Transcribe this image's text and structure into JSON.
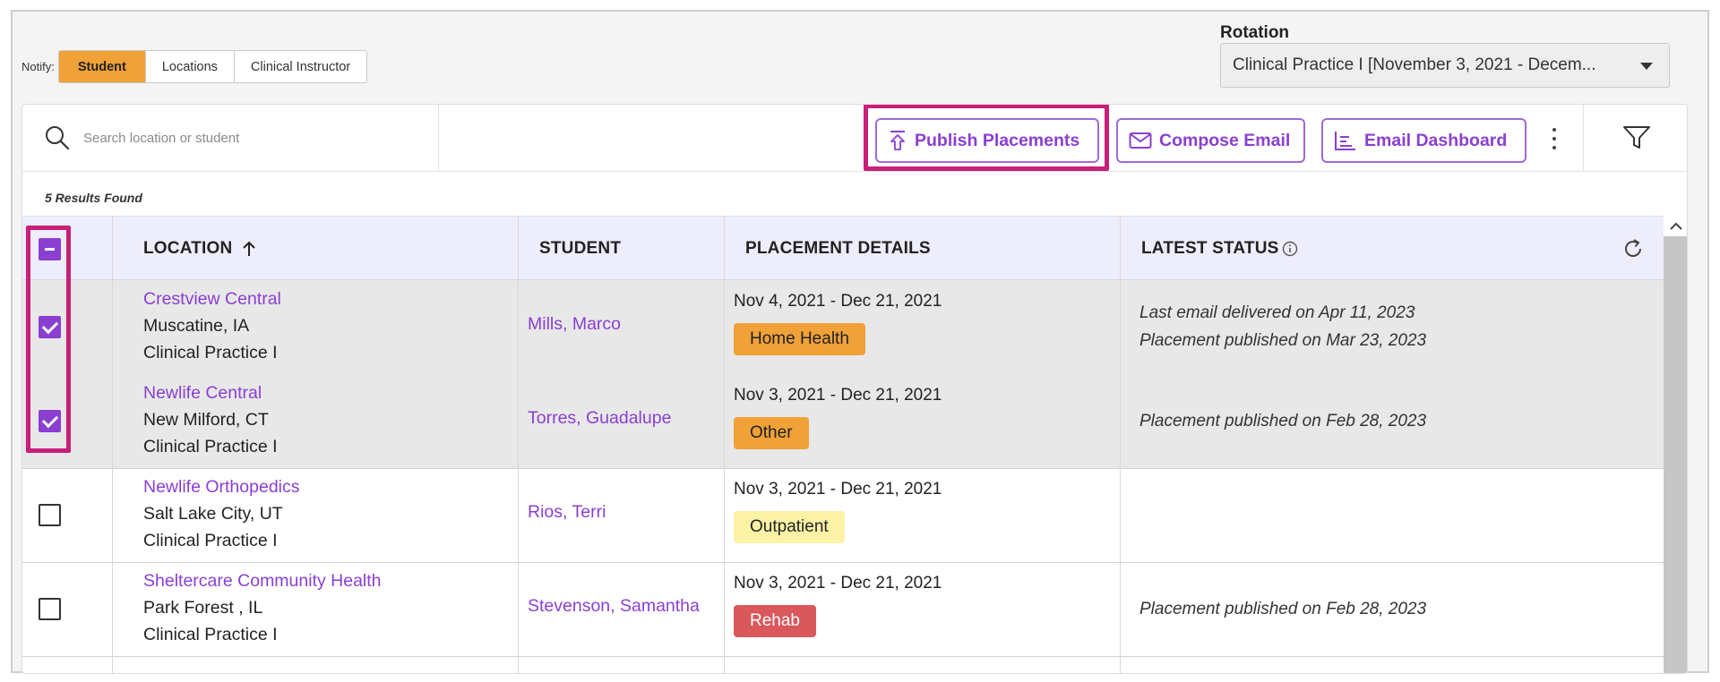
{
  "notify": {
    "label": "Notify:",
    "options": [
      "Student",
      "Locations",
      "Clinical Instructor"
    ],
    "active": "Student"
  },
  "rotation": {
    "label": "Rotation",
    "value": "Clinical Practice I [November 3, 2021 - Decem..."
  },
  "toolbar": {
    "search_placeholder": "Search location or student",
    "publish_label": "Publish Placements",
    "compose_label": "Compose Email",
    "dashboard_label": "Email Dashboard"
  },
  "results_text": "5 Results Found",
  "table": {
    "headers": {
      "location": "LOCATION",
      "student": "STUDENT",
      "placement": "PLACEMENT DETAILS",
      "status": "LATEST STATUS"
    },
    "rows": [
      {
        "checked": true,
        "location": "Crestview Central",
        "city": "Muscatine, IA",
        "course": "Clinical Practice I",
        "student": "Mills, Marco",
        "dates": "Nov 4, 2021 - Dec 21, 2021",
        "tag": "Home Health",
        "tag_color": "#f0a138",
        "tag_text_color": "#222222",
        "status": [
          "Last email delivered on Apr 11, 2023",
          "Placement published on Mar 23, 2023"
        ]
      },
      {
        "checked": true,
        "location": "Newlife Central",
        "city": "New Milford, CT",
        "course": "Clinical Practice I",
        "student": "Torres, Guadalupe",
        "dates": "Nov 3, 2021 - Dec 21, 2021",
        "tag": "Other",
        "tag_color": "#f0a138",
        "tag_text_color": "#222222",
        "status": [
          "Placement published on Feb 28, 2023"
        ]
      },
      {
        "checked": false,
        "location": "Newlife Orthopedics",
        "city": "Salt Lake City, UT",
        "course": "Clinical Practice I",
        "student": "Rios, Terri",
        "dates": "Nov 3, 2021 - Dec 21, 2021",
        "tag": "Outpatient",
        "tag_color": "#fbf2a6",
        "tag_text_color": "#222222",
        "status": []
      },
      {
        "checked": false,
        "location": "Sheltercare Community Health",
        "city": "Park Forest , IL",
        "course": "Clinical Practice I",
        "student": "Stevenson, Samantha",
        "dates": "Nov 3, 2021 - Dec 21, 2021",
        "tag": "Rehab",
        "tag_color": "#d9585c",
        "tag_text_color": "#ffffff",
        "status": [
          "Placement published on Feb 28, 2023"
        ]
      }
    ]
  },
  "colors": {
    "accent": "#8a3fd1",
    "highlight": "#c81f78",
    "active_segment": "#f0a138",
    "header_bg": "#eeedfc"
  }
}
